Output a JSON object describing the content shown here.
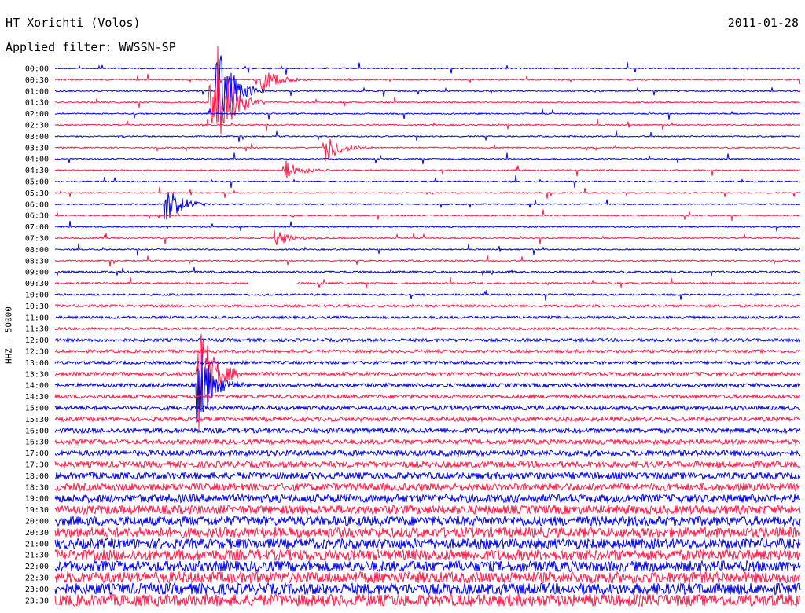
{
  "header": {
    "station": "HT Xorichti (Volos)",
    "date": "2011-01-28",
    "filter_label": "Applied filter: WWSSN-SP"
  },
  "channel_label": "HHZ - 50000",
  "colors": {
    "blue": "#0000ee",
    "red": "#ff1a4a",
    "background": "#ffffff"
  },
  "chart_data": {
    "type": "line",
    "title": "HT Xorichti (Volos)",
    "subtitle": "Applied filter: WWSSN-SP",
    "ylabel": "HHZ - 50000",
    "y_tick_labels": [
      "00:00",
      "00:30",
      "01:00",
      "01:30",
      "02:00",
      "02:30",
      "03:00",
      "03:30",
      "04:00",
      "04:30",
      "05:00",
      "05:30",
      "06:00",
      "06:30",
      "07:00",
      "07:30",
      "08:00",
      "08:30",
      "09:00",
      "09:30",
      "10:00",
      "10:30",
      "11:00",
      "11:30",
      "12:00",
      "12:30",
      "13:00",
      "13:30",
      "14:00",
      "14:30",
      "15:00",
      "15:30",
      "16:00",
      "16:30",
      "17:00",
      "17:30",
      "18:00",
      "18:30",
      "19:00",
      "19:30",
      "20:00",
      "20:30",
      "21:00",
      "21:30",
      "22:00",
      "22:30",
      "23:00",
      "23:30"
    ],
    "row_duration_minutes": 30,
    "alternating_colors": [
      "#0000ee",
      "#ff1a4a"
    ],
    "noise_level_by_row": [
      1,
      1,
      1,
      1,
      1,
      1,
      1,
      1,
      1,
      1,
      1,
      1,
      1,
      1,
      1,
      1,
      1,
      1,
      1.5,
      1.5,
      1.5,
      2,
      2,
      2,
      2.5,
      2.5,
      2.5,
      3,
      3,
      3,
      3.5,
      3.5,
      4,
      4,
      4.5,
      5,
      5.5,
      6,
      6.5,
      7,
      7.5,
      8,
      8,
      8.5,
      8.5,
      9,
      9,
      9.5
    ],
    "events": [
      {
        "row": 1,
        "minute": 8.4,
        "amplitude": 3
      },
      {
        "row": 2,
        "minute": 6.6,
        "amplitude": 10
      },
      {
        "row": 3,
        "minute": 6.3,
        "amplitude": 5
      },
      {
        "row": 3,
        "minute": 6.6,
        "amplitude": 9
      },
      {
        "row": 7,
        "minute": 11.0,
        "amplitude": 3
      },
      {
        "row": 9,
        "minute": 9.3,
        "amplitude": 2
      },
      {
        "row": 12,
        "minute": 4.5,
        "amplitude": 4
      },
      {
        "row": 15,
        "minute": 8.9,
        "amplitude": 2
      },
      {
        "row": 27,
        "minute": 5.8,
        "amplitude": 12
      },
      {
        "row": 28,
        "minute": 5.8,
        "amplitude": 8
      }
    ],
    "gaps": [
      {
        "row": 19,
        "start_minute": 7.8,
        "end_minute": 9.7
      }
    ],
    "grid": false
  }
}
